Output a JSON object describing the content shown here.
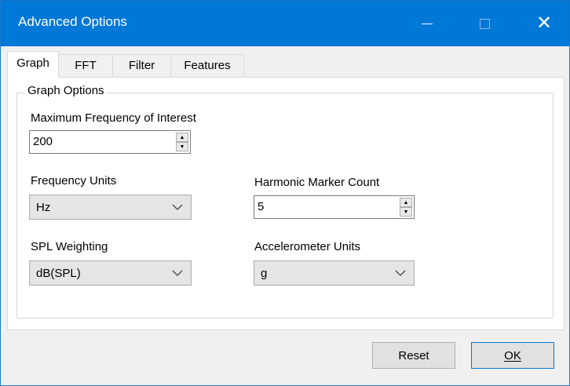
{
  "window": {
    "title": "Advanced Options"
  },
  "tabs": [
    {
      "label": "Graph",
      "active": true
    },
    {
      "label": "FFT",
      "active": false
    },
    {
      "label": "Filter",
      "active": false
    },
    {
      "label": "Features",
      "active": false
    }
  ],
  "group": {
    "title": "Graph Options",
    "max_freq": {
      "label": "Maximum Frequency of Interest",
      "value": "200"
    },
    "freq_units": {
      "label": "Frequency Units",
      "value": "Hz"
    },
    "harmonic_count": {
      "label": "Harmonic Marker Count",
      "value": "5"
    },
    "spl_weighting": {
      "label": "SPL Weighting",
      "value": "dB(SPL)"
    },
    "accel_units": {
      "label": "Accelerometer Units",
      "value": "g"
    }
  },
  "buttons": {
    "reset": "Reset",
    "ok": "OK"
  },
  "colors": {
    "titlebar": "#0078d7",
    "accent": "#0078d7"
  }
}
